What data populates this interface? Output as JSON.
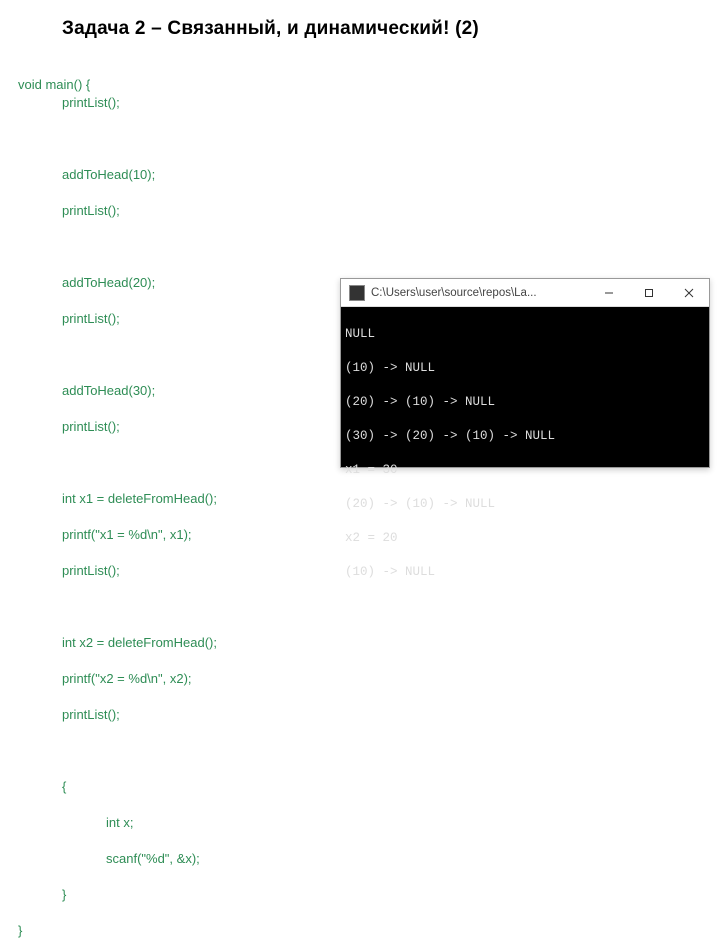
{
  "title": "Задача 2 – Связанный, и динамический! (2)",
  "code": {
    "l1": "void main() {",
    "l2": "printList();",
    "l3": "addToHead(10);",
    "l4": "printList();",
    "l5": "addToHead(20);",
    "l6": "printList();",
    "l7": "addToHead(30);",
    "l8": "printList();",
    "l9": "int x1 = deleteFromHead();",
    "l10": "printf(\"x1 = %d\\n\", x1);",
    "l11": "printList();",
    "l12": "int x2 = deleteFromHead();",
    "l13": "printf(\"x2 = %d\\n\", x2);",
    "l14": "printList();",
    "l15": "{",
    "l16": "int x;",
    "l17": "scanf(\"%d\", &x);",
    "l18": "}",
    "l19": "}"
  },
  "console": {
    "title": "C:\\Users\\user\\source\\repos\\La...",
    "lines": [
      "NULL",
      "(10) -> NULL",
      "(20) -> (10) -> NULL",
      "(30) -> (20) -> (10) -> NULL",
      "x1 = 30",
      "(20) -> (10) -> NULL",
      "x2 = 20",
      "(10) -> NULL"
    ]
  }
}
